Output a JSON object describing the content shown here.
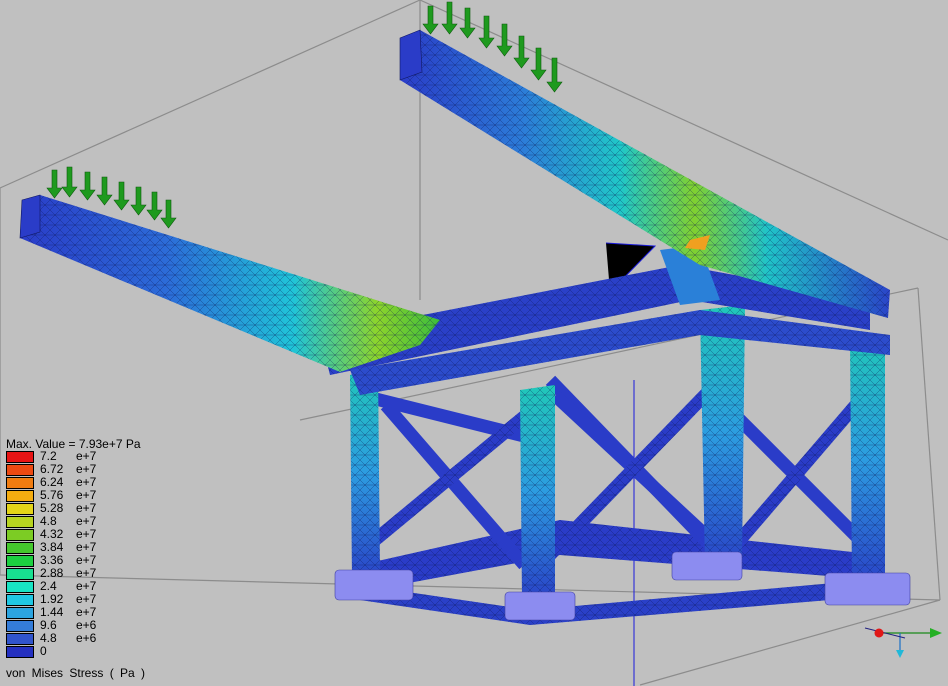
{
  "legend": {
    "max_label": "Max. Value = 7.93e+7 Pa",
    "caption": "von Mises  Stress  ( Pa )",
    "rows": [
      {
        "value": "7.2",
        "exp": "e+7",
        "color": "#e81414"
      },
      {
        "value": "6.72",
        "exp": "e+7",
        "color": "#ec4a12"
      },
      {
        "value": "6.24",
        "exp": "e+7",
        "color": "#f07c10"
      },
      {
        "value": "5.76",
        "exp": "e+7",
        "color": "#f4ac10"
      },
      {
        "value": "5.28",
        "exp": "e+7",
        "color": "#e4d418"
      },
      {
        "value": "4.8",
        "exp": "e+7",
        "color": "#b8d420"
      },
      {
        "value": "4.32",
        "exp": "e+7",
        "color": "#7ccc24"
      },
      {
        "value": "3.84",
        "exp": "e+7",
        "color": "#44c82c"
      },
      {
        "value": "3.36",
        "exp": "e+7",
        "color": "#1cd040"
      },
      {
        "value": "2.88",
        "exp": "e+7",
        "color": "#18e090"
      },
      {
        "value": "2.4",
        "exp": "e+7",
        "color": "#18e4c4"
      },
      {
        "value": "1.92",
        "exp": "e+7",
        "color": "#20c8e4"
      },
      {
        "value": "1.44",
        "exp": "e+7",
        "color": "#2ca4e0"
      },
      {
        "value": "9.6",
        "exp": "e+6",
        "color": "#347cd8"
      },
      {
        "value": "4.8",
        "exp": "e+6",
        "color": "#3054cc"
      },
      {
        "value": "0",
        "exp": "",
        "color": "#2430c0"
      }
    ]
  },
  "colors": {
    "background": "#c0c0c0",
    "low_stress": "#2a3cc8",
    "load_arrow": "#1e9a1e",
    "support": "#8c8cf0",
    "bounding_box": "#909090",
    "axis_line": "#1a1adc"
  }
}
